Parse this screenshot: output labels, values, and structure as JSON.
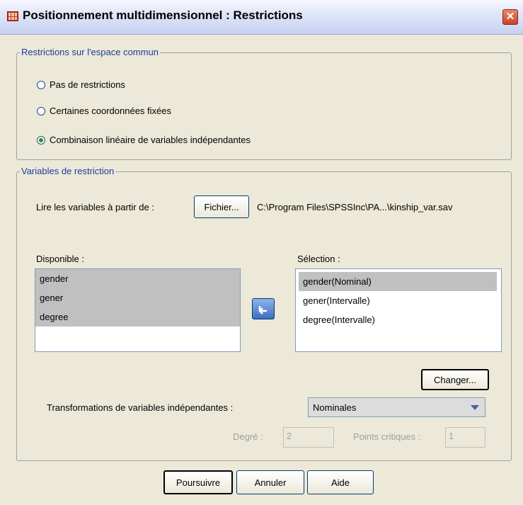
{
  "window": {
    "title": "Positionnement multidimensionnel : Restrictions"
  },
  "common_space": {
    "group_title": "Restrictions sur l'espace commun",
    "options": [
      {
        "label": "Pas de restrictions",
        "selected": false
      },
      {
        "label": "Certaines coordonnées fixées",
        "selected": false
      },
      {
        "label": "Combinaison linéaire de variables indépendantes",
        "selected": true
      }
    ]
  },
  "restriction_vars": {
    "group_title": "Variables de restriction",
    "read_label": "Lire les variables à partir de :",
    "file_button": "Fichier...",
    "file_path": "C:\\Program Files\\SPSSInc\\PA...\\kinship_var.sav",
    "available_label": "Disponible :",
    "available": [
      "gender",
      "gener",
      "degree"
    ],
    "selection_label": "Sélection :",
    "selection": [
      "gender(Nominal)",
      "gener(Intervalle)",
      "degree(Intervalle)"
    ],
    "change_button": "Changer...",
    "transform_label": "Transformations de variables indépendantes :",
    "transform_value": "Nominales",
    "degree_label": "Degré :",
    "degree_value": "2",
    "knots_label": "Points critiques :",
    "knots_value": "1"
  },
  "buttons": {
    "continue": "Poursuivre",
    "cancel": "Annuler",
    "help": "Aide"
  }
}
